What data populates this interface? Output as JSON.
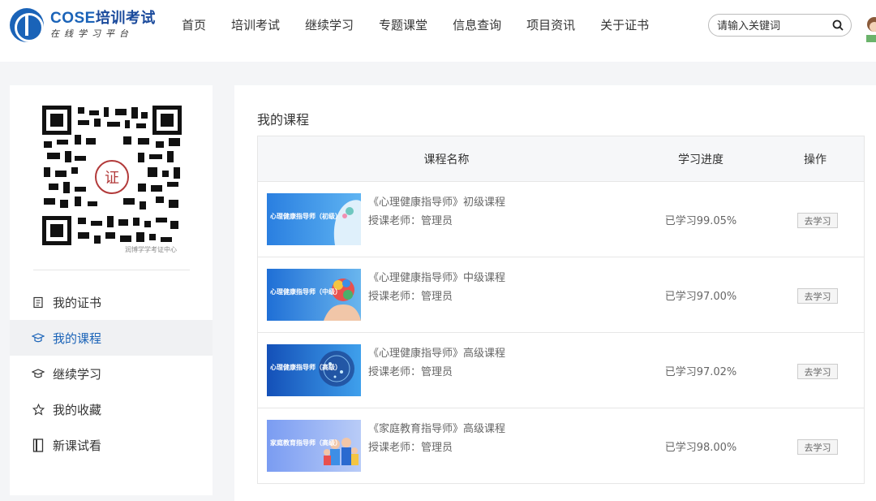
{
  "header": {
    "logo_title_latin": "COSE",
    "logo_title_cn": "培训考试",
    "logo_subtitle": "在线学习平台",
    "nav": [
      "首页",
      "培训考试",
      "继续学习",
      "专题课堂",
      "信息查询",
      "项目资讯",
      "关于证书"
    ],
    "search_placeholder": "请输入关键词",
    "search_icon": "search-icon"
  },
  "sidebar": {
    "qr_caption": "润博学学考证中心",
    "menu": [
      {
        "label": "我的证书",
        "icon": "certificate-icon",
        "active": false
      },
      {
        "label": "我的课程",
        "icon": "graduation-cap-icon",
        "active": true
      },
      {
        "label": "继续学习",
        "icon": "graduation-cap-icon",
        "active": false
      },
      {
        "label": "我的收藏",
        "icon": "star-icon",
        "active": false
      },
      {
        "label": "新课试看",
        "icon": "book-icon",
        "active": false
      }
    ]
  },
  "main": {
    "title": "我的课程",
    "columns": [
      "课程名称",
      "学习进度",
      "操作"
    ],
    "courses": [
      {
        "title": "《心理健康指导师》初级课程",
        "teacher": "授课老师：管理员",
        "progress_text": "已学习99.05%",
        "action": "去学习",
        "thumb_label": "心理健康指导师（初级）"
      },
      {
        "title": "《心理健康指导师》中级课程",
        "teacher": "授课老师：管理员",
        "progress_text": "已学习97.00%",
        "action": "去学习",
        "thumb_label": "心理健康指导师（中级）"
      },
      {
        "title": "《心理健康指导师》高级课程",
        "teacher": "授课老师：管理员",
        "progress_text": "已学习97.02%",
        "action": "去学习",
        "thumb_label": "心理健康指导师（高级）"
      },
      {
        "title": "《家庭教育指导师》高级课程",
        "teacher": "授课老师：管理员",
        "progress_text": "已学习98.00%",
        "action": "去学习",
        "thumb_label": "家庭教育指导师（高级）"
      }
    ]
  },
  "colors": {
    "brand": "#1a63b8",
    "active_bg": "#f0f1f3",
    "page_bg": "#f4f5f7"
  }
}
